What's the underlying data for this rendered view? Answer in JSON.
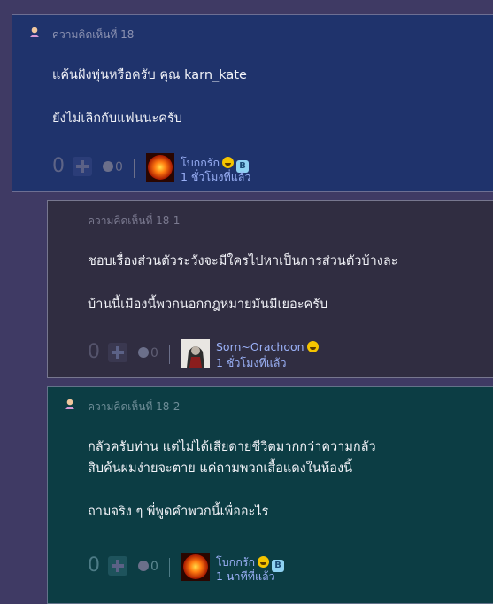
{
  "comments": [
    {
      "header": "ความคิดเห็นที่ 18",
      "lines": [
        "แค้นฝังหุ่นหรือครับ คุณ karn_kate",
        "ยังไม่เลิกกับแฟนนะครับ"
      ],
      "vote_count": "0",
      "emotion_count": "0",
      "username": "โบกกรัก",
      "user_badge": "B",
      "timestamp": "1 ชั่วโมงที่แล้ว"
    },
    {
      "header": "ความคิดเห็นที่ 18-1",
      "lines": [
        "ชอบเรื่องส่วนตัวระวังจะมีใครไปหาเป็นการส่วนตัวบ้างละ",
        "บ้านนี้เมืองนี้พวกนอกกฎหมายมันมีเยอะครับ"
      ],
      "vote_count": "0",
      "emotion_count": "0",
      "username": "Sorn~Orachoon",
      "timestamp": "1 ชั่วโมงที่แล้ว"
    },
    {
      "header": "ความคิดเห็นที่ 18-2",
      "lines": [
        "กลัวครับท่าน แต่ไม่ได้เสียดายชีวิตมากกว่าความกลัว",
        "สิบค้นผมง่ายจะตาย แค่ถามพวกเสื้อแดงในห้องนี้",
        "ถามจริง ๆ พี่พูดคำพวกนี้เพื่ออะไร"
      ],
      "vote_count": "0",
      "emotion_count": "0",
      "username": "โบกกรัก",
      "user_badge": "B",
      "timestamp": "1 นาทีที่แล้ว"
    }
  ],
  "colors": {
    "page_bg": "#3f3a64",
    "comment_1_bg": "#1f336c",
    "comment_2_bg": "#302d41",
    "comment_3_bg": "#0c3d44",
    "link_text": "#9ab0f6"
  },
  "icons": [
    "user-icon",
    "plus-icon",
    "sad-face-icon",
    "grin-emoticon",
    "b-badge-icon"
  ]
}
